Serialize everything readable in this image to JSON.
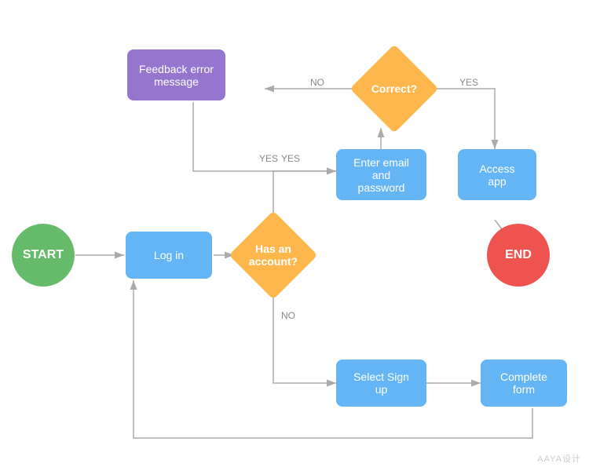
{
  "nodes": {
    "start": {
      "label": "START",
      "color": "green",
      "type": "circle"
    },
    "end": {
      "label": "END",
      "color": "red",
      "type": "circle"
    },
    "login": {
      "label": "Log in",
      "color": "blue",
      "type": "rect"
    },
    "feedback": {
      "label": "Feedback error message",
      "color": "purple",
      "type": "rect"
    },
    "enter_email": {
      "label": "Enter email and password",
      "color": "blue",
      "type": "rect"
    },
    "access_app": {
      "label": "Access app",
      "color": "blue",
      "type": "rect"
    },
    "select_signup": {
      "label": "Select Sign up",
      "color": "blue",
      "type": "rect"
    },
    "complete_form": {
      "label": "Complete form",
      "color": "blue",
      "type": "rect"
    },
    "has_account": {
      "label": "Has an account?",
      "color": "orange",
      "type": "diamond"
    },
    "correct": {
      "label": "Correct?",
      "color": "orange",
      "type": "diamond"
    }
  },
  "arrows": {
    "yes_label": "YES",
    "no_label": "NO"
  },
  "watermark": "AAYA设计"
}
